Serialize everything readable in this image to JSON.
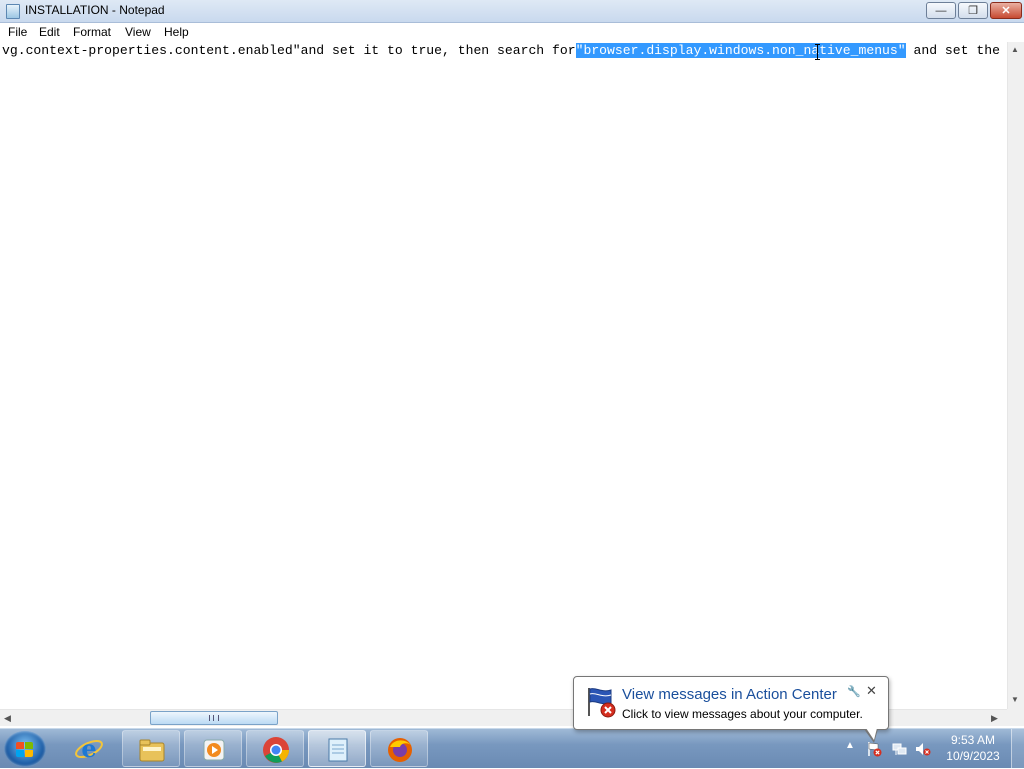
{
  "window": {
    "title": "INSTALLATION - Notepad",
    "minimize_label": "—",
    "maximize_label": "❐",
    "close_label": "✕"
  },
  "menu": {
    "items": [
      "File",
      "Edit",
      "Format",
      "View",
      "Help"
    ]
  },
  "editor": {
    "line_before": "vg.context-properties.content.enabled\"and set it to true, then search for",
    "selected_text": "\"browser.display.windows.non_native_menus\"",
    "line_after": " and set the"
  },
  "scrollbars": {
    "up_arrow": "▲",
    "down_arrow": "▼",
    "left_arrow": "◀",
    "right_arrow": "▶"
  },
  "taskbar": {
    "pinned_apps": [
      "internet-explorer",
      "windows-explorer",
      "windows-media-player",
      "google-chrome",
      "notepad",
      "firefox"
    ],
    "active_app": "notepad",
    "clock_time": "9:53 AM",
    "clock_date": "10/9/2023",
    "tray_icons": [
      "show-hidden-icons",
      "action-center-flag",
      "network",
      "volume-muted"
    ]
  },
  "notification": {
    "title": "View messages in Action Center",
    "text": "Click to view messages about your computer.",
    "close_label": "✕",
    "options_label": "🔧"
  },
  "colors": {
    "selection": "#3399ff",
    "titlebar": "#dfe9f5",
    "taskbar": "#7898bf",
    "notification_title": "#1a4f9c"
  }
}
